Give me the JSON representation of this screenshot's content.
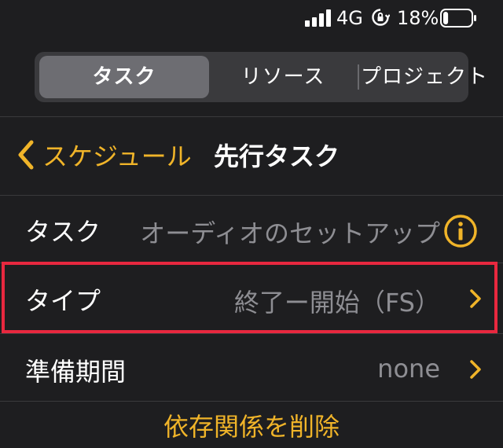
{
  "status_bar": {
    "network": "4G",
    "battery_percent": "18%",
    "battery_level": 0.18,
    "icons": [
      "signal-icon",
      "rotation-lock-icon",
      "battery-icon"
    ]
  },
  "segments": {
    "items": [
      {
        "label": "タスク",
        "selected": true
      },
      {
        "label": "リソース",
        "selected": false
      },
      {
        "label": "プロジェクト",
        "selected": false
      }
    ]
  },
  "nav": {
    "back_label": "スケジュール",
    "title": "先行タスク"
  },
  "rows": {
    "task": {
      "label": "タスク",
      "value": "オーディオのセットアップ",
      "icon": "info-icon"
    },
    "type": {
      "label": "タイプ",
      "value": "終了ー開始（FS）",
      "icon": "chevron-right-icon"
    },
    "lead": {
      "label": "準備期間",
      "value": "none",
      "icon": "chevron-right-icon"
    }
  },
  "actions": {
    "delete_label": "依存関係を削除"
  },
  "colors": {
    "accent": "#f0b429",
    "highlight": "#e8283f",
    "background": "#1e1e20",
    "secondary_text": "#8e8e93"
  }
}
